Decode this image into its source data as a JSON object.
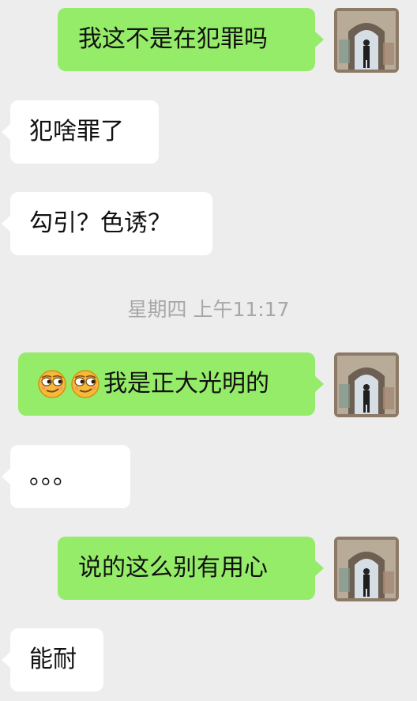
{
  "conversation": {
    "messages": [
      {
        "from": "me",
        "text": "我这不是在犯罪吗"
      },
      {
        "from": "other",
        "text": "犯啥罪了"
      },
      {
        "from": "other",
        "text": "勾引？色诱？"
      },
      {
        "from": "me",
        "text": "我是正大光明的",
        "emoji": [
          "smirk-emoji",
          "smirk-emoji"
        ]
      },
      {
        "from": "other",
        "text": "。。。"
      },
      {
        "from": "me",
        "text": "说的这么别有用心"
      },
      {
        "from": "other",
        "text": "能耐"
      }
    ],
    "timestamp": "星期四 上午11:17"
  },
  "colors": {
    "background": "#ededed",
    "outgoing_bubble": "#95ec69",
    "incoming_bubble": "#ffffff",
    "timestamp_text": "#a7a7a7"
  }
}
